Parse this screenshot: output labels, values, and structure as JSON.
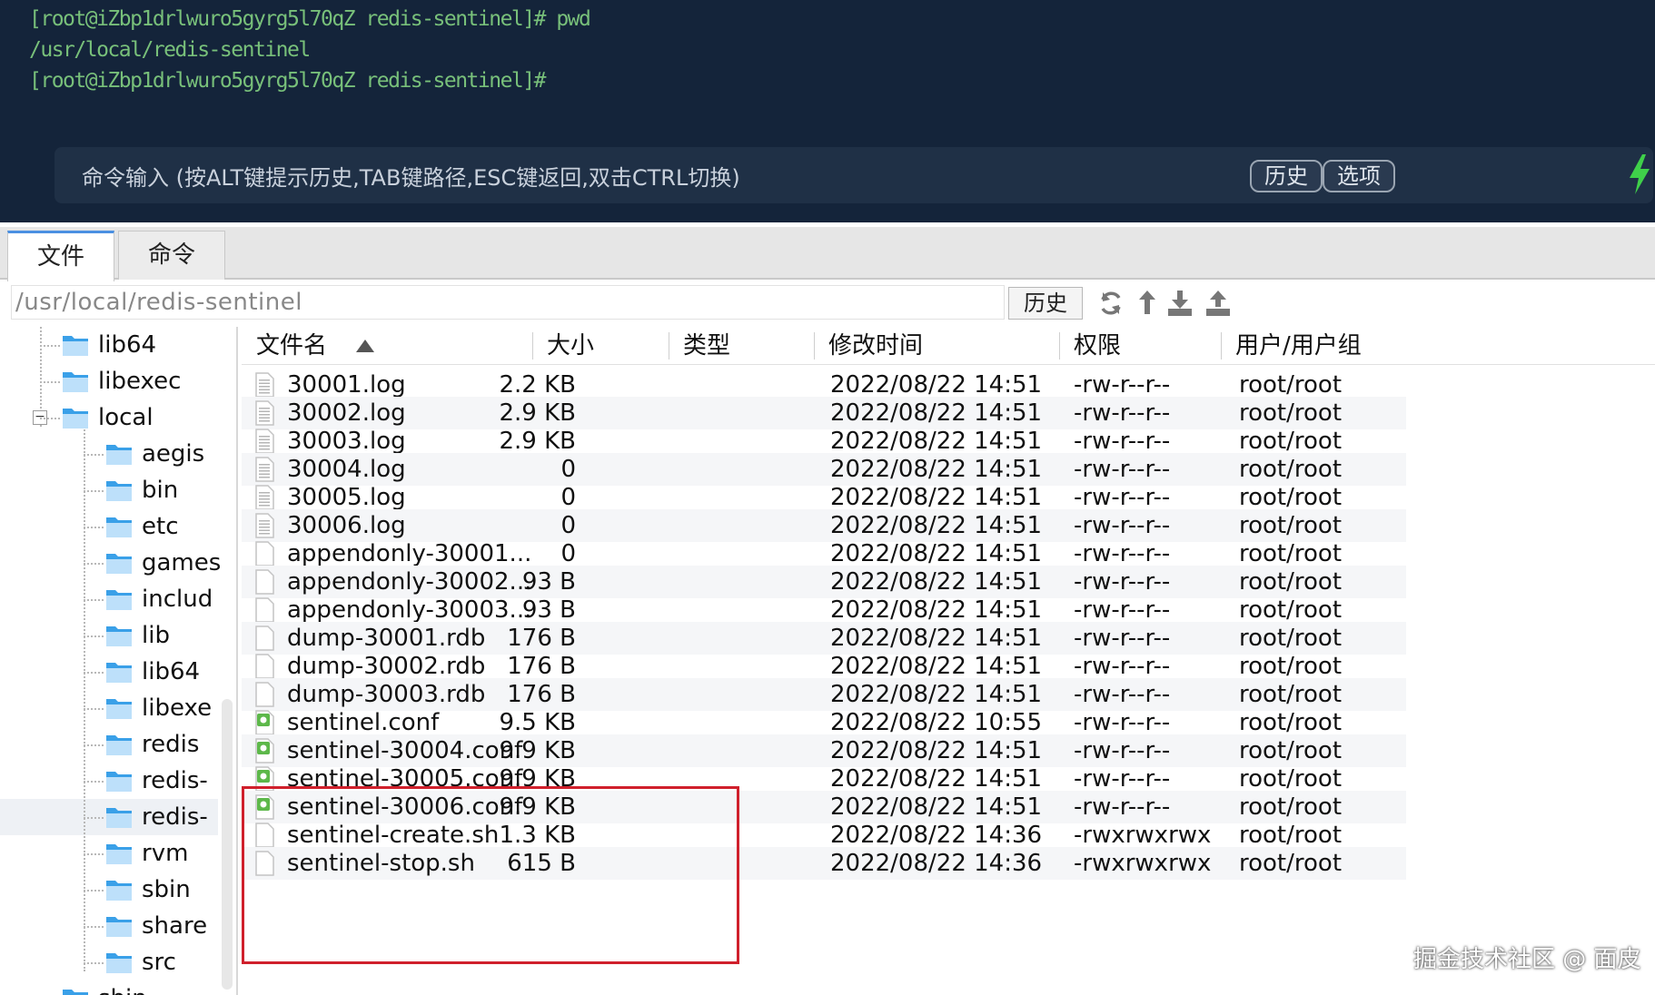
{
  "terminal": {
    "lines": [
      "[root@iZbp1drlwuro5gyrg5l70qZ redis-sentinel]# pwd",
      "/usr/local/redis-sentinel",
      "[root@iZbp1drlwuro5gyrg5l70qZ redis-sentinel]#"
    ],
    "command_placeholder": "命令输入 (按ALT键提示历史,TAB键路径,ESC键返回,双击CTRL切换)",
    "history_button": "历史",
    "options_button": "选项"
  },
  "tabs": [
    "文件",
    "命令"
  ],
  "path_bar": {
    "path": "/usr/local/redis-sentinel",
    "history_button": "历史"
  },
  "tree": {
    "items": [
      {
        "label": "lib64",
        "level": 0
      },
      {
        "label": "libexec",
        "level": 0
      },
      {
        "label": "local",
        "level": 0
      },
      {
        "label": "aegis",
        "level": 1
      },
      {
        "label": "bin",
        "level": 1
      },
      {
        "label": "etc",
        "level": 1
      },
      {
        "label": "games",
        "level": 1
      },
      {
        "label": "includ",
        "level": 1
      },
      {
        "label": "lib",
        "level": 1
      },
      {
        "label": "lib64",
        "level": 1
      },
      {
        "label": "libexe",
        "level": 1
      },
      {
        "label": "redis",
        "level": 1
      },
      {
        "label": "redis-",
        "level": 1
      },
      {
        "label": "redis-",
        "level": 1
      },
      {
        "label": "rvm",
        "level": 1
      },
      {
        "label": "sbin",
        "level": 1
      },
      {
        "label": "share",
        "level": 1
      },
      {
        "label": "src",
        "level": 1
      },
      {
        "label": "sbin",
        "level": 0
      }
    ],
    "collapse_symbol": "−"
  },
  "table": {
    "headers": [
      "文件名",
      "大小",
      "类型",
      "修改时间",
      "权限",
      "用户/用户组"
    ],
    "rows": [
      {
        "name": "30001.log",
        "size": "2.2 KB",
        "mtime": "2022/08/22 14:51",
        "perm": "-rw-r--r--",
        "owner": "root/root",
        "icon": "log-file-icon"
      },
      {
        "name": "30002.log",
        "size": "2.9 KB",
        "mtime": "2022/08/22 14:51",
        "perm": "-rw-r--r--",
        "owner": "root/root",
        "icon": "log-file-icon"
      },
      {
        "name": "30003.log",
        "size": "2.9 KB",
        "mtime": "2022/08/22 14:51",
        "perm": "-rw-r--r--",
        "owner": "root/root",
        "icon": "log-file-icon"
      },
      {
        "name": "30004.log",
        "size": "0",
        "mtime": "2022/08/22 14:51",
        "perm": "-rw-r--r--",
        "owner": "root/root",
        "icon": "log-file-icon"
      },
      {
        "name": "30005.log",
        "size": "0",
        "mtime": "2022/08/22 14:51",
        "perm": "-rw-r--r--",
        "owner": "root/root",
        "icon": "log-file-icon"
      },
      {
        "name": "30006.log",
        "size": "0",
        "mtime": "2022/08/22 14:51",
        "perm": "-rw-r--r--",
        "owner": "root/root",
        "icon": "log-file-icon"
      },
      {
        "name": "appendonly-30001...",
        "size": "0",
        "mtime": "2022/08/22 14:51",
        "perm": "-rw-r--r--",
        "owner": "root/root",
        "icon": "blank-file-icon"
      },
      {
        "name": "appendonly-30002...",
        "size": "93 B",
        "mtime": "2022/08/22 14:51",
        "perm": "-rw-r--r--",
        "owner": "root/root",
        "icon": "blank-file-icon"
      },
      {
        "name": "appendonly-30003...",
        "size": "93 B",
        "mtime": "2022/08/22 14:51",
        "perm": "-rw-r--r--",
        "owner": "root/root",
        "icon": "blank-file-icon"
      },
      {
        "name": "dump-30001.rdb",
        "size": "176 B",
        "mtime": "2022/08/22 14:51",
        "perm": "-rw-r--r--",
        "owner": "root/root",
        "icon": "blank-file-icon"
      },
      {
        "name": "dump-30002.rdb",
        "size": "176 B",
        "mtime": "2022/08/22 14:51",
        "perm": "-rw-r--r--",
        "owner": "root/root",
        "icon": "blank-file-icon"
      },
      {
        "name": "dump-30003.rdb",
        "size": "176 B",
        "mtime": "2022/08/22 14:51",
        "perm": "-rw-r--r--",
        "owner": "root/root",
        "icon": "blank-file-icon"
      },
      {
        "name": "sentinel.conf",
        "size": "9.5 KB",
        "mtime": "2022/08/22 10:55",
        "perm": "-rw-r--r--",
        "owner": "root/root",
        "icon": "config-file-icon"
      },
      {
        "name": "sentinel-30004.conf",
        "size": "9.9 KB",
        "mtime": "2022/08/22 14:51",
        "perm": "-rw-r--r--",
        "owner": "root/root",
        "icon": "config-file-icon"
      },
      {
        "name": "sentinel-30005.conf",
        "size": "9.9 KB",
        "mtime": "2022/08/22 14:51",
        "perm": "-rw-r--r--",
        "owner": "root/root",
        "icon": "config-file-icon"
      },
      {
        "name": "sentinel-30006.conf",
        "size": "9.9 KB",
        "mtime": "2022/08/22 14:51",
        "perm": "-rw-r--r--",
        "owner": "root/root",
        "icon": "config-file-icon"
      },
      {
        "name": "sentinel-create.sh",
        "size": "1.3 KB",
        "mtime": "2022/08/22 14:36",
        "perm": "-rwxrwxrwx",
        "owner": "root/root",
        "icon": "blank-file-icon"
      },
      {
        "name": "sentinel-stop.sh",
        "size": "615 B",
        "mtime": "2022/08/22 14:36",
        "perm": "-rwxrwxrwx",
        "owner": "root/root",
        "icon": "blank-file-icon"
      }
    ]
  },
  "watermark": "掘金技术社区 @ 面皮",
  "colors": {
    "terminal_bg": "#14243a",
    "terminal_text": "#78c07a",
    "highlight_border": "#d0202c",
    "tab_accent": "#4a90e2",
    "folder": "#3aa0e8"
  }
}
